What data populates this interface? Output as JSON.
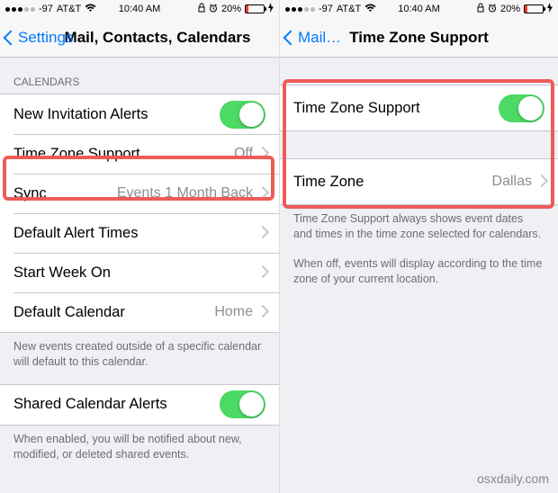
{
  "status": {
    "signal_text": "-97",
    "carrier": "AT&T",
    "time": "10:40 AM",
    "battery_pct": "20%"
  },
  "left": {
    "back_label": "Settings",
    "title": "Mail, Contacts, Calendars",
    "section_header": "CALENDARS",
    "rows": {
      "new_invitation_alerts": "New Invitation Alerts",
      "time_zone_support": "Time Zone Support",
      "time_zone_support_value": "Off",
      "sync": "Sync",
      "sync_value": "Events 1 Month Back",
      "default_alert_times": "Default Alert Times",
      "start_week_on": "Start Week On",
      "default_calendar": "Default Calendar",
      "default_calendar_value": "Home"
    },
    "footer1": "New events created outside of a specific calendar will default to this calendar.",
    "shared_alerts": "Shared Calendar Alerts",
    "footer2": "When enabled, you will be notified about new, modified, or deleted shared events."
  },
  "right": {
    "back_label": "Mail…",
    "title": "Time Zone Support",
    "rows": {
      "time_zone_support": "Time Zone Support",
      "time_zone": "Time Zone",
      "time_zone_value": "Dallas"
    },
    "footer1": "Time Zone Support always shows event dates and times in the time zone selected for calendars.",
    "footer2": "When off, events will display according to the time zone of your current location."
  },
  "watermark": "osxdaily.com",
  "icons": {
    "wifi": "wifi-icon",
    "lock": "lock-icon",
    "alarm": "alarm-icon",
    "charge": "charge-icon"
  }
}
